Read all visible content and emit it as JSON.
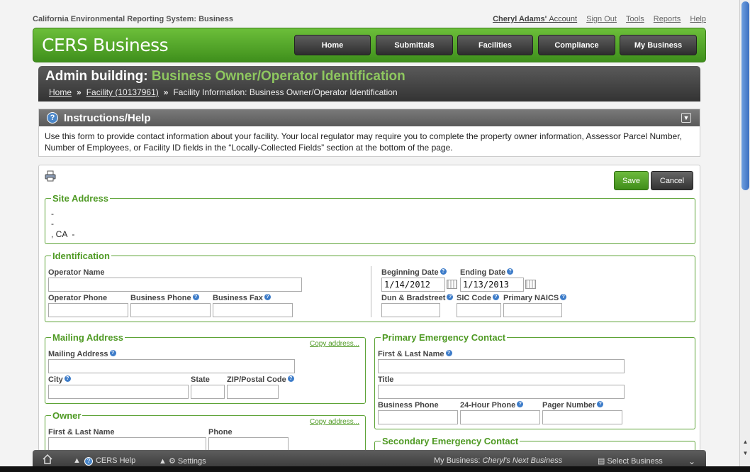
{
  "app": {
    "system_name": "California Environmental Reporting System: Business",
    "brand": "CERS Business"
  },
  "toplinks": {
    "user": "Cheryl Adams'",
    "account": "Account",
    "sign_out": "Sign Out",
    "tools": "Tools",
    "reports": "Reports",
    "help": "Help"
  },
  "nav": [
    "Home",
    "Submittals",
    "Facilities",
    "Compliance",
    "My Business"
  ],
  "page": {
    "title_prefix": "Admin building:",
    "title_main": "Business Owner/Operator Identification"
  },
  "breadcrumb": {
    "home": "Home",
    "facility": "Facility (10137961)",
    "current": "Facility Information: Business Owner/Operator Identification"
  },
  "help": {
    "title": "Instructions/Help",
    "text": "Use this form to provide contact information about your facility. Your local regulator may require you to complete the property owner information, Assessor Parcel Number, Number of Employees, or Facility ID fields in the “Locally-Collected Fields” section at the bottom of the page."
  },
  "buttons": {
    "save": "Save",
    "cancel": "Cancel"
  },
  "site": {
    "legend": "Site Address",
    "line1": "-",
    "line2": "-",
    "line3": ", CA  -"
  },
  "ident": {
    "legend": "Identification",
    "operator_name": "Operator Name",
    "operator_phone": "Operator Phone",
    "business_phone": "Business Phone",
    "business_fax": "Business Fax",
    "beginning_date": "Beginning Date",
    "ending_date": "Ending Date",
    "beginning_value": "1/14/2012",
    "ending_value": "1/13/2013",
    "dun": "Dun & Bradstreet",
    "sic": "SIC Code",
    "naics": "Primary NAICS"
  },
  "mailing": {
    "legend": "Mailing Address",
    "copy": "Copy address...",
    "address": "Mailing Address",
    "city": "City",
    "state": "State",
    "zip": "ZIP/Postal Code"
  },
  "owner": {
    "legend": "Owner",
    "copy": "Copy address...",
    "name": "First & Last Name",
    "phone": "Phone"
  },
  "primary": {
    "legend": "Primary Emergency Contact",
    "name": "First & Last Name",
    "title": "Title",
    "business_phone": "Business Phone",
    "hour24": "24-Hour Phone",
    "pager": "Pager Number"
  },
  "secondary": {
    "legend": "Secondary Emergency Contact"
  },
  "bottom": {
    "help": "CERS Help",
    "settings": "Settings",
    "my_business_label": "My Business:",
    "my_business_value": "Cheryl's Next Business",
    "select": "Select Business"
  }
}
